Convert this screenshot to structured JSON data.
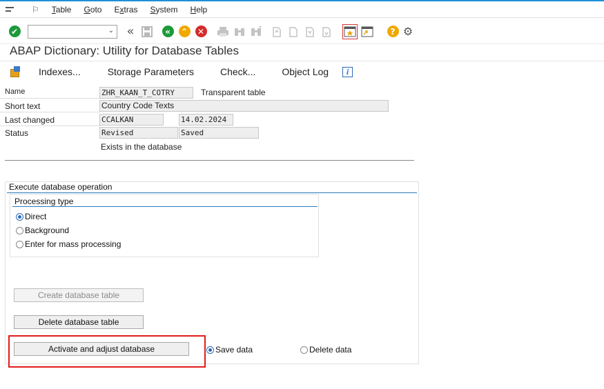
{
  "menubar": {
    "items": [
      {
        "label": "Table",
        "underline": "T",
        "rest": "able"
      },
      {
        "label": "Goto",
        "underline": "G",
        "rest": "oto"
      },
      {
        "label": "Extras",
        "underline": "x",
        "pre": "E",
        "rest": "tras"
      },
      {
        "label": "System",
        "underline": "S",
        "rest": "ystem"
      },
      {
        "label": "Help",
        "underline": "H",
        "rest": "elp"
      }
    ]
  },
  "toolbar": {
    "command_field": "",
    "colors": {
      "green": "#1c9a3a",
      "yellow": "#f0a800",
      "red": "#d42b2b",
      "help": "#f0a800"
    }
  },
  "title": "ABAP Dictionary: Utility for Database Tables",
  "app_toolbar": {
    "indexes": "Indexes...",
    "storage": "Storage Parameters",
    "check": "Check...",
    "object_log": "Object Log"
  },
  "form": {
    "name_label": "Name",
    "name_value": "ZHR_KAAN_T_COTRY",
    "table_type": "Transparent table",
    "short_text_label": "Short text",
    "short_text_value": "Country Code Texts",
    "last_changed_label": "Last changed",
    "last_changed_user": "CCALKAN",
    "last_changed_date": "14.02.2024",
    "status_label": "Status",
    "status_version": "Revised",
    "status_save": "Saved",
    "db_status": "Exists in the database"
  },
  "execute": {
    "title": "Execute database operation",
    "processing_title": "Processing type",
    "options": {
      "direct": "Direct",
      "background": "Background",
      "mass": "Enter for mass processing"
    },
    "selected": "direct",
    "create_button": "Create database table",
    "delete_button": "Delete database table",
    "activate_button": "Activate and adjust database",
    "save_data": "Save data",
    "delete_data": "Delete data",
    "data_selected": "save_data"
  }
}
